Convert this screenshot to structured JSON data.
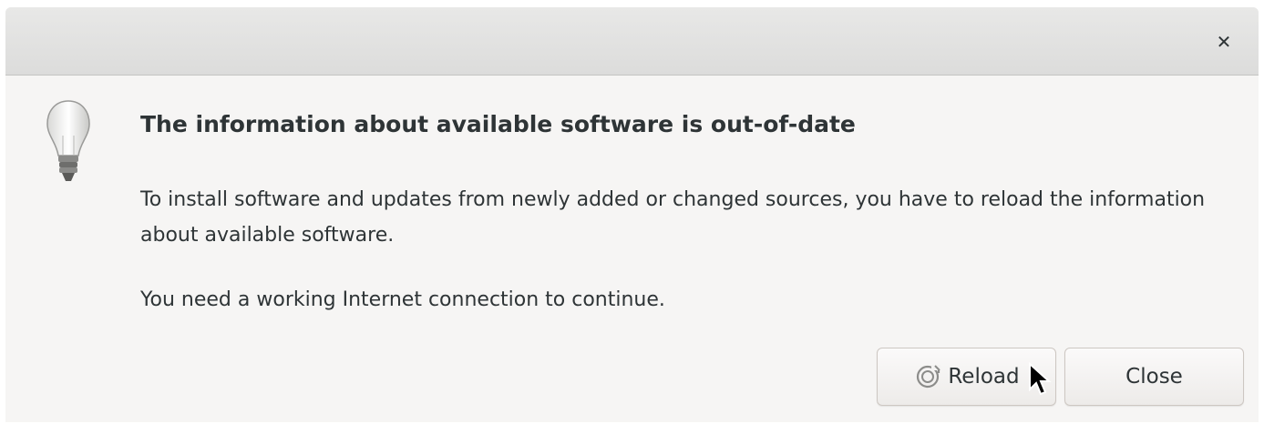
{
  "window": {
    "close_icon": "close-icon"
  },
  "message": {
    "icon": "lightbulb-icon",
    "heading": "The information about available software is out-of-date",
    "body": "To install software and updates from newly added or changed sources, you have to reload the information about available software.",
    "note": "You need a working Internet connection to continue."
  },
  "buttons": {
    "reload_label": "Reload",
    "reload_icon": "reload-icon",
    "close_label": "Close"
  },
  "colors": {
    "text": "#2e3436",
    "dialog_bg": "#f6f5f4",
    "titlebar_bg": "#dcdcdb"
  }
}
